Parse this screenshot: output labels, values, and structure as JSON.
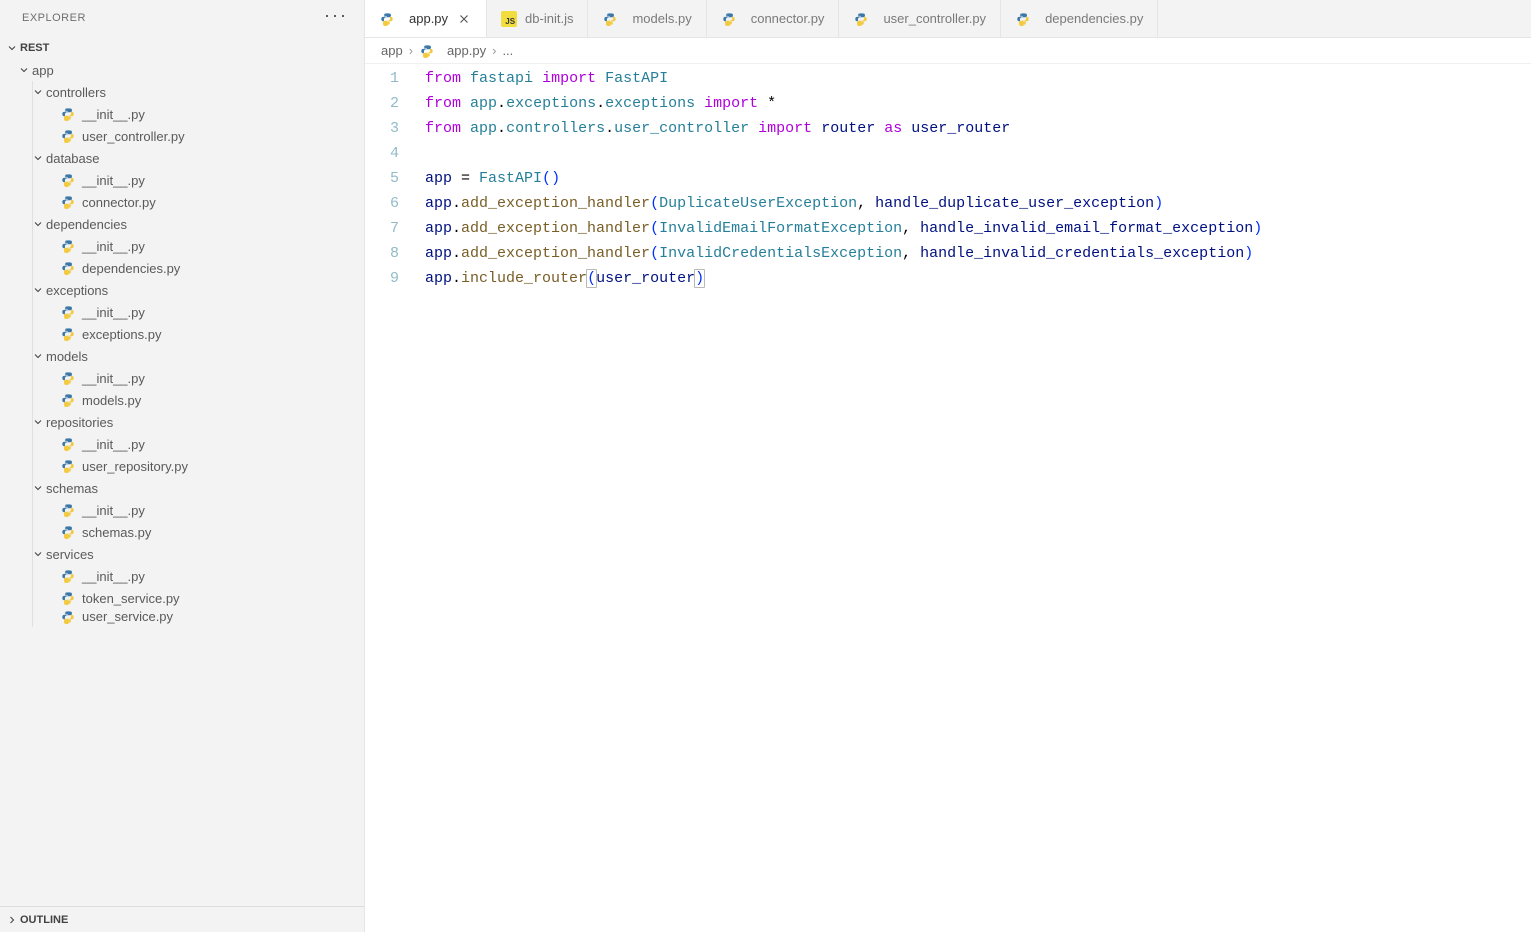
{
  "explorer": {
    "title": "EXPLORER",
    "more": "···",
    "sections": {
      "rest": "REST",
      "outline": "OUTLINE"
    },
    "tree": [
      {
        "type": "folder",
        "label": "app",
        "indent": 1,
        "open": true
      },
      {
        "type": "folder",
        "label": "controllers",
        "indent": 2,
        "open": true
      },
      {
        "type": "file",
        "label": "__init__.py",
        "indent": 3,
        "icon": "python"
      },
      {
        "type": "file",
        "label": "user_controller.py",
        "indent": 3,
        "icon": "python"
      },
      {
        "type": "folder",
        "label": "database",
        "indent": 2,
        "open": true
      },
      {
        "type": "file",
        "label": "__init__.py",
        "indent": 3,
        "icon": "python"
      },
      {
        "type": "file",
        "label": "connector.py",
        "indent": 3,
        "icon": "python"
      },
      {
        "type": "folder",
        "label": "dependencies",
        "indent": 2,
        "open": true
      },
      {
        "type": "file",
        "label": "__init__.py",
        "indent": 3,
        "icon": "python"
      },
      {
        "type": "file",
        "label": "dependencies.py",
        "indent": 3,
        "icon": "python"
      },
      {
        "type": "folder",
        "label": "exceptions",
        "indent": 2,
        "open": true
      },
      {
        "type": "file",
        "label": "__init__.py",
        "indent": 3,
        "icon": "python"
      },
      {
        "type": "file",
        "label": "exceptions.py",
        "indent": 3,
        "icon": "python"
      },
      {
        "type": "folder",
        "label": "models",
        "indent": 2,
        "open": true
      },
      {
        "type": "file",
        "label": "__init__.py",
        "indent": 3,
        "icon": "python"
      },
      {
        "type": "file",
        "label": "models.py",
        "indent": 3,
        "icon": "python"
      },
      {
        "type": "folder",
        "label": "repositories",
        "indent": 2,
        "open": true
      },
      {
        "type": "file",
        "label": "__init__.py",
        "indent": 3,
        "icon": "python"
      },
      {
        "type": "file",
        "label": "user_repository.py",
        "indent": 3,
        "icon": "python"
      },
      {
        "type": "folder",
        "label": "schemas",
        "indent": 2,
        "open": true
      },
      {
        "type": "file",
        "label": "__init__.py",
        "indent": 3,
        "icon": "python"
      },
      {
        "type": "file",
        "label": "schemas.py",
        "indent": 3,
        "icon": "python"
      },
      {
        "type": "folder",
        "label": "services",
        "indent": 2,
        "open": true
      },
      {
        "type": "file",
        "label": "__init__.py",
        "indent": 3,
        "icon": "python"
      },
      {
        "type": "file",
        "label": "token_service.py",
        "indent": 3,
        "icon": "python"
      },
      {
        "type": "file",
        "label": "user_service.py",
        "indent": 3,
        "icon": "python",
        "cut": true
      }
    ]
  },
  "tabs": [
    {
      "label": "app.py",
      "icon": "python",
      "active": true
    },
    {
      "label": "db-init.js",
      "icon": "js",
      "active": false
    },
    {
      "label": "models.py",
      "icon": "python",
      "active": false
    },
    {
      "label": "connector.py",
      "icon": "python",
      "active": false
    },
    {
      "label": "user_controller.py",
      "icon": "python",
      "active": false
    },
    {
      "label": "dependencies.py",
      "icon": "python",
      "active": false
    }
  ],
  "breadcrumbs": {
    "parts": [
      "app",
      "app.py",
      "..."
    ],
    "icons": [
      null,
      "python",
      null
    ]
  },
  "editor": {
    "lines": [
      {
        "n": 1,
        "tokens": [
          {
            "c": "kw",
            "t": "from"
          },
          {
            "c": "op",
            "t": " "
          },
          {
            "c": "mod",
            "t": "fastapi"
          },
          {
            "c": "op",
            "t": " "
          },
          {
            "c": "kw",
            "t": "import"
          },
          {
            "c": "op",
            "t": " "
          },
          {
            "c": "mod",
            "t": "FastAPI"
          }
        ]
      },
      {
        "n": 2,
        "tokens": [
          {
            "c": "kw",
            "t": "from"
          },
          {
            "c": "op",
            "t": " "
          },
          {
            "c": "mod",
            "t": "app"
          },
          {
            "c": "op",
            "t": "."
          },
          {
            "c": "mod",
            "t": "exceptions"
          },
          {
            "c": "op",
            "t": "."
          },
          {
            "c": "mod",
            "t": "exceptions"
          },
          {
            "c": "op",
            "t": " "
          },
          {
            "c": "kw",
            "t": "import"
          },
          {
            "c": "op",
            "t": " "
          },
          {
            "c": "star",
            "t": "*"
          }
        ]
      },
      {
        "n": 3,
        "tokens": [
          {
            "c": "kw",
            "t": "from"
          },
          {
            "c": "op",
            "t": " "
          },
          {
            "c": "mod",
            "t": "app"
          },
          {
            "c": "op",
            "t": "."
          },
          {
            "c": "mod",
            "t": "controllers"
          },
          {
            "c": "op",
            "t": "."
          },
          {
            "c": "mod",
            "t": "user_controller"
          },
          {
            "c": "op",
            "t": " "
          },
          {
            "c": "kw",
            "t": "import"
          },
          {
            "c": "op",
            "t": " "
          },
          {
            "c": "var",
            "t": "router"
          },
          {
            "c": "op",
            "t": " "
          },
          {
            "c": "kw",
            "t": "as"
          },
          {
            "c": "op",
            "t": " "
          },
          {
            "c": "var",
            "t": "user_router"
          }
        ]
      },
      {
        "n": 4,
        "tokens": []
      },
      {
        "n": 5,
        "tokens": [
          {
            "c": "var",
            "t": "app"
          },
          {
            "c": "op",
            "t": " = "
          },
          {
            "c": "mod",
            "t": "FastAPI"
          },
          {
            "c": "paren",
            "t": "("
          },
          {
            "c": "paren",
            "t": ")"
          }
        ]
      },
      {
        "n": 6,
        "tokens": [
          {
            "c": "var",
            "t": "app"
          },
          {
            "c": "op",
            "t": "."
          },
          {
            "c": "fn",
            "t": "add_exception_handler"
          },
          {
            "c": "paren",
            "t": "("
          },
          {
            "c": "mod",
            "t": "DuplicateUserException"
          },
          {
            "c": "op",
            "t": ", "
          },
          {
            "c": "var",
            "t": "handle_duplicate_user_exception"
          },
          {
            "c": "paren",
            "t": ")"
          }
        ]
      },
      {
        "n": 7,
        "tokens": [
          {
            "c": "var",
            "t": "app"
          },
          {
            "c": "op",
            "t": "."
          },
          {
            "c": "fn",
            "t": "add_exception_handler"
          },
          {
            "c": "paren",
            "t": "("
          },
          {
            "c": "mod",
            "t": "InvalidEmailFormatException"
          },
          {
            "c": "op",
            "t": ", "
          },
          {
            "c": "var",
            "t": "handle_invalid_email_format_exception"
          },
          {
            "c": "paren",
            "t": ")"
          }
        ]
      },
      {
        "n": 8,
        "tokens": [
          {
            "c": "var",
            "t": "app"
          },
          {
            "c": "op",
            "t": "."
          },
          {
            "c": "fn",
            "t": "add_exception_handler"
          },
          {
            "c": "paren",
            "t": "("
          },
          {
            "c": "mod",
            "t": "InvalidCredentialsException"
          },
          {
            "c": "op",
            "t": ", "
          },
          {
            "c": "var",
            "t": "handle_invalid_credentials_exception"
          },
          {
            "c": "paren",
            "t": ")"
          }
        ]
      },
      {
        "n": 9,
        "tokens": [
          {
            "c": "var",
            "t": "app"
          },
          {
            "c": "op",
            "t": "."
          },
          {
            "c": "fn",
            "t": "include_router"
          },
          {
            "c": "paren bracket-hl",
            "t": "("
          },
          {
            "c": "var",
            "t": "user_router"
          },
          {
            "c": "paren bracket-hl",
            "t": ")"
          }
        ]
      }
    ]
  },
  "icons": {
    "js_badge": "JS"
  }
}
